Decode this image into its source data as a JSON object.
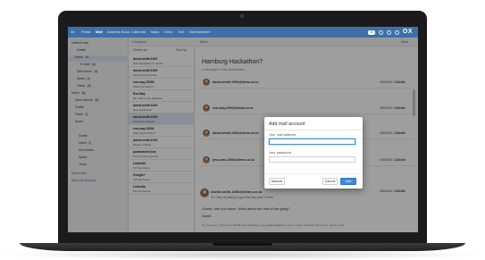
{
  "topbar": {
    "nav": [
      "All",
      "Portal",
      "Mail",
      "Address Book",
      "Calendar",
      "Tasks",
      "Drive",
      "Text",
      "Spreadsheet"
    ],
    "active": "Mail",
    "badge": "30",
    "logo": "OX"
  },
  "toolbar": {
    "compose": "Compose",
    "more": "More",
    "view": "View",
    "select_all": "Select all",
    "sort": "Sort by"
  },
  "folders": [
    {
      "label": "Unified mail",
      "count": ""
    },
    {
      "label": "Drafts",
      "count": ""
    },
    {
      "label": "Inbox",
      "count": "30"
    },
    {
      "label": "E-Mail",
      "count": "24"
    },
    {
      "label": "Sent items",
      "count": "21"
    },
    {
      "label": "Spam",
      "count": "8"
    },
    {
      "label": "Trash",
      "count": "18"
    },
    {
      "label": "Inbox",
      "count": "24"
    },
    {
      "label": "Sent objects",
      "count": "18"
    },
    {
      "label": "Drafts",
      "count": ""
    },
    {
      "label": "Trash",
      "count": "2"
    },
    {
      "label": "Spam",
      "count": ""
    },
    {
      "label": "Drafts",
      "count": ""
    },
    {
      "label": "Inbox",
      "count": "4"
    },
    {
      "label": "Sent items",
      "count": ""
    },
    {
      "label": "Spam",
      "count": ""
    },
    {
      "label": "Trash",
      "count": ""
    },
    {
      "label": "New folder",
      "count": ""
    },
    {
      "label": "Add mail account",
      "count": ""
    }
  ],
  "messages": [
    {
      "from": "david.smith.1000",
      "date": "4/09/2014 12:11 AM",
      "subject": "New appointment: Hamb..."
    },
    {
      "from": "david.smith.1000",
      "date": "4/09/2014 12:10 AM",
      "subject": "Need Overview File"
    },
    {
      "from": "eva.may.10000",
      "date": "4/09/2014 12:10 AM",
      "subject": "Welcome back to..."
    },
    {
      "from": "Eva May",
      "date": "4/09/2014 12:10 AM",
      "subject": "Re: I like to the database"
    },
    {
      "from": "david.smith.1000",
      "date": "4/09/2014 12:10 AM",
      "subject": "New publication"
    },
    {
      "from": "david.smith.1000",
      "date": "4/09/2014 12:10 AM",
      "subject": "Hamburg Hackath..."
    },
    {
      "from": "eva.may.10000",
      "date": "4/09/2014 12:10 AM",
      "subject": "After Work Drinks?"
    },
    {
      "from": "david.smith.1000",
      "date": "4/09/2014 12:10 AM",
      "subject": "Please Call Me"
    },
    {
      "from": "postmaster@ox",
      "date": "4/08/2014 8:30 AM",
      "subject": "OX Test Demo Email"
    },
    {
      "from": "LinkedIn",
      "date": "2/13/2014 4:07 AM",
      "subject": "OX Test Demo"
    },
    {
      "from": "Google+",
      "date": "2/13/2014 3:31 PM",
      "subject": "OX Test Demo"
    },
    {
      "from": "LinkedIn",
      "date": "2/13/2014 8:46 PM",
      "subject": "OX Test Demo"
    }
  ],
  "thread": {
    "title": "Hamburg Hackathon?",
    "subtitle": "4 messages in this conversation",
    "rows": [
      {
        "from": "david.smith.1000@demo.ox.io",
        "date": "4/09/2014 12:10 AM",
        "action": "Actions"
      },
      {
        "from": "eva.may.1000@demo.ox.io",
        "date": "4/09/2014 12:10 AM",
        "action": "Actions"
      },
      {
        "from": "david.smith.1000@demo.ox.io",
        "date": "4/09/2014 12:10 AM",
        "action": "Actions"
      },
      {
        "from": "jess.cmo.1000@demo.ox.io",
        "date": "4/09/2014 12:10 AM",
        "action": "Actions"
      }
    ],
    "detail": {
      "from": "david.smith.1000@demo.ox.io",
      "date": "4/09/2014 12:10 AM",
      "action": "Actions",
      "to": "To: Gary Goldberg   Copy: Eva May   and 5 more",
      "body1": "Guess, see you there. What about the rest of the gang?",
      "body2": "David",
      "quote": "On January 7, 2014 at 11:48 PM Gary Goldberg <gary.goldberg@demo.ox.io> wrote: Hi David, I'll be there. Need to find"
    }
  },
  "modal": {
    "title": "Add mail account",
    "address_label": "Your mail address",
    "address_value": "",
    "password_label": "Your password",
    "password_value": "",
    "manual": "Manual",
    "cancel": "Cancel",
    "add": "Add"
  }
}
